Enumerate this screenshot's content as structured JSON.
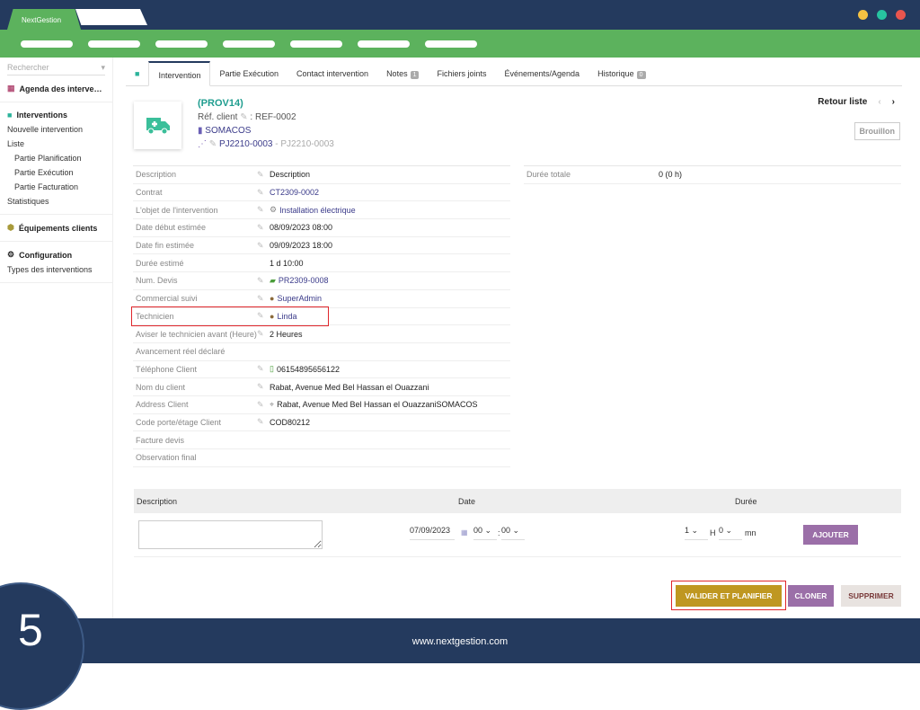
{
  "app": {
    "name": "NextGestion",
    "window_dots": [
      "#f5c242",
      "#27c3a0",
      "#e8554e"
    ]
  },
  "sidebar": {
    "search_placeholder": "Rechercher",
    "agenda": "Agenda des interve…",
    "interventions": "Interventions",
    "items": [
      "Nouvelle intervention",
      "Liste"
    ],
    "sub": [
      "Partie Planification",
      "Partie Exécution",
      "Partie Facturation"
    ],
    "stats": "Statistiques",
    "equipements": "Équipements clients",
    "configuration": "Configuration",
    "types": "Types des interventions"
  },
  "tabs": [
    {
      "label": "Intervention"
    },
    {
      "label": "Partie Exécution"
    },
    {
      "label": "Contact intervention"
    },
    {
      "label": "Notes",
      "badge": "1"
    },
    {
      "label": "Fichiers joints"
    },
    {
      "label": "Événements/Agenda"
    },
    {
      "label": "Historique",
      "badge": "0"
    }
  ],
  "header": {
    "ref": "(PROV14)",
    "ref_client_label": "Réf. client",
    "ref_client": ": REF-0002",
    "company": "SOMACOS",
    "project": "PJ2210-0003",
    "project_sub": " - PJ2210-0003",
    "back": "Retour liste",
    "status": "Brouillon"
  },
  "fields": [
    {
      "label": "Description",
      "value": "Description"
    },
    {
      "label": "Contrat",
      "value": "CT2309-0002"
    },
    {
      "label": "L'objet de l'intervention",
      "value": "Installation électrique"
    },
    {
      "label": "Date début estimée",
      "value": "08/09/2023 08:00"
    },
    {
      "label": "Date fin estimée",
      "value": "09/09/2023 18:00"
    },
    {
      "label": "Durée estimé",
      "value": "1 d 10:00"
    },
    {
      "label": "Num. Devis",
      "value": "PR2309-0008"
    },
    {
      "label": "Commercial suivi",
      "value": "SuperAdmin"
    },
    {
      "label": "Technicien",
      "value": "Linda"
    },
    {
      "label": "Aviser le technicien avant (Heure)",
      "value": "2 Heures"
    },
    {
      "label": "Avancement réel déclaré",
      "value": ""
    },
    {
      "label": "Téléphone Client",
      "value": "06154895656122"
    },
    {
      "label": "Nom du client",
      "value": "Rabat, Avenue Med Bel Hassan el Ouazzani"
    },
    {
      "label": "Address Client",
      "value": "Rabat, Avenue Med Bel Hassan el OuazzaniSOMACOS"
    },
    {
      "label": "Code porte/étage Client",
      "value": "COD80212"
    },
    {
      "label": "Facture devis",
      "value": ""
    },
    {
      "label": "Observation final",
      "value": ""
    }
  ],
  "right": {
    "label": "Durée totale",
    "value": "0 (0 h)"
  },
  "line_form": {
    "h_desc": "Description",
    "h_date": "Date",
    "h_duree": "Durée",
    "date": "07/09/2023",
    "hour": "00",
    "sep": ":",
    "min": "00",
    "dur_h": "1",
    "h": "H",
    "dur_m": "0",
    "mn": "mn",
    "add": "AJOUTER"
  },
  "actions": {
    "validate": "VALIDER ET PLANIFIER",
    "clone": "CLONER",
    "delete": "SUPPRIMER"
  },
  "footer": {
    "url": "www.nextgestion.com",
    "step": "5"
  }
}
